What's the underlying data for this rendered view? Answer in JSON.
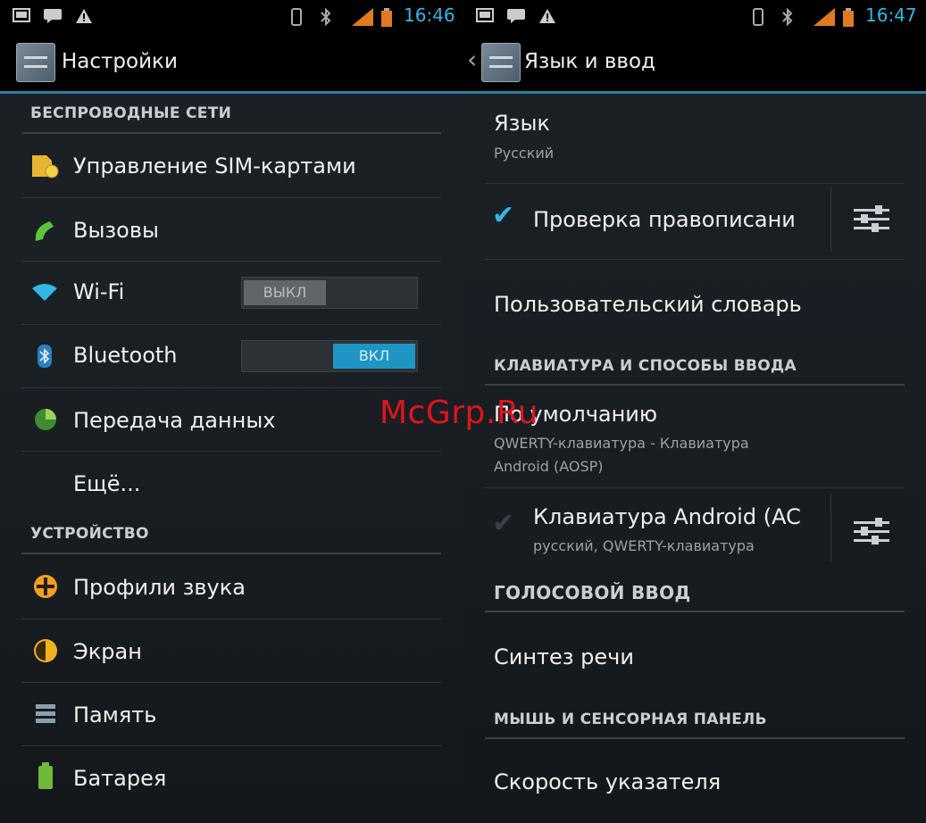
{
  "left": {
    "status": {
      "time": "16:46"
    },
    "title": "Настройки",
    "sections": [
      {
        "header": "БЕСПРОВОДНЫЕ СЕТИ",
        "items": [
          {
            "label": "Управление SIM-картами",
            "icon": "sim-card-icon"
          },
          {
            "label": "Вызовы",
            "icon": "phone-icon"
          },
          {
            "label": "Wi-Fi",
            "icon": "wifi-icon",
            "toggle": "ВЫКЛ"
          },
          {
            "label": "Bluetooth",
            "icon": "bluetooth-icon",
            "toggle": "ВКЛ"
          },
          {
            "label": "Передача данных",
            "icon": "data-usage-icon"
          },
          {
            "label": "Ещё..."
          }
        ]
      },
      {
        "header": "УСТРОЙСТВО",
        "items": [
          {
            "label": "Профили звука",
            "icon": "sound-profile-icon"
          },
          {
            "label": "Экран",
            "icon": "display-icon"
          },
          {
            "label": "Память",
            "icon": "storage-icon"
          },
          {
            "label": "Батарея",
            "icon": "battery-icon"
          }
        ]
      }
    ]
  },
  "right": {
    "status": {
      "time": "16:47"
    },
    "title": "Язык и ввод",
    "language": {
      "label": "Язык",
      "value": "Русский"
    },
    "spellcheck": {
      "label": "Проверка правописани",
      "checked": true
    },
    "user_dictionary": "Пользовательский словарь",
    "keyboard_header": "КЛАВИАТУРА И СПОСОБЫ ВВОДА",
    "default": {
      "label": "По умолчанию",
      "sub1": "QWERTY-клавиатура - Клавиатура",
      "sub2": "Android (AOSP)"
    },
    "android_keyboard": {
      "label": "Клавиатура Android (AC",
      "sub": "русский, QWERTY-клавиатура",
      "checked": true
    },
    "voice_header": "ГОЛОСОВОЙ ВВОД",
    "tts": "Синтез речи",
    "mouse_header": "МЫШЬ И СЕНСОРНАЯ ПАНЕЛЬ",
    "pointer_speed": "Скорость указателя"
  },
  "watermark": "McGrp.Ru",
  "colors": {
    "accent": "#33b5e5",
    "toggle_on": "#1f95c6",
    "watermark": "#e0141c"
  }
}
